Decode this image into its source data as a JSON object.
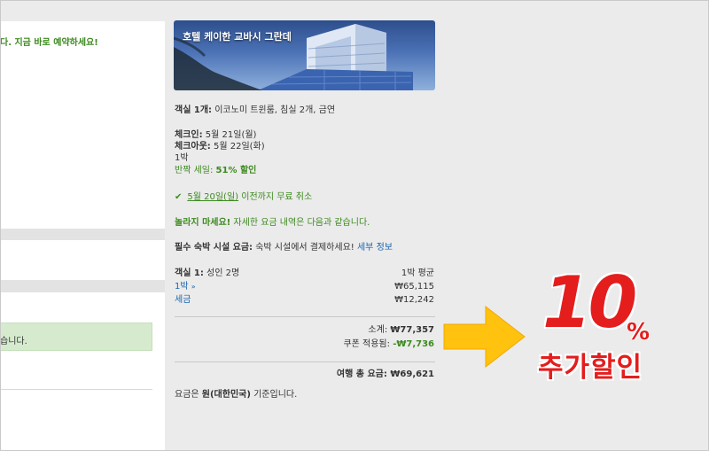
{
  "left_panel": {
    "promo_text": "다. 지금 바로 예약하세요!",
    "notice_text": "습니다."
  },
  "hotel": {
    "name": "호텔 케이한 교바시 그란데"
  },
  "booking": {
    "room_label": "객실 1개:",
    "room_desc": " 이코노미 트윈룸, 침실 2개, 금연",
    "checkin_label": "체크인:",
    "checkin_value": " 5월 21일(월)",
    "checkout_label": "체크아웃:",
    "checkout_value": " 5월 22일(화)",
    "nights": "1박",
    "sale_prefix": "반짝 세일: ",
    "sale_value": "51% 할인",
    "cancel_date": "5월 20일(일)",
    "cancel_text": " 이전까지 무료 취소",
    "surprise_bold": "놀라지 마세요!",
    "surprise_text": " 자세한 요금 내역은 다음과 같습니다.",
    "mandatory_bold": "필수 숙박 시설 요금:",
    "mandatory_text": " 숙박 시설에서 결제하세요! ",
    "details_link": "세부 정보"
  },
  "price": {
    "room_label": "객실 1:",
    "room_guests": " 성인 2명",
    "avg_label": "1박 평균",
    "night_link": "1박",
    "night_chevron": "»",
    "night_value": "₩65,115",
    "tax_link": "세금",
    "tax_value": "₩12,242",
    "subtotal_label": "소계: ",
    "subtotal_value": "₩77,357",
    "coupon_label": "쿠폰 적용됨: ",
    "coupon_value": "-₩7,736",
    "total_label": "여행 총 요금: ",
    "total_value": "₩69,621",
    "currency_prefix": "요금은 ",
    "currency_bold": "원(대한민국)",
    "currency_suffix": " 기준입니다."
  },
  "promo": {
    "number": "10",
    "percent": "%",
    "subtitle": "추가할인"
  },
  "colors": {
    "background": "#ebebeb",
    "green": "#3d8a1f",
    "link_blue": "#1a64b0",
    "promo_red": "#e41d1d",
    "arrow_yellow": "#ffc20e"
  }
}
